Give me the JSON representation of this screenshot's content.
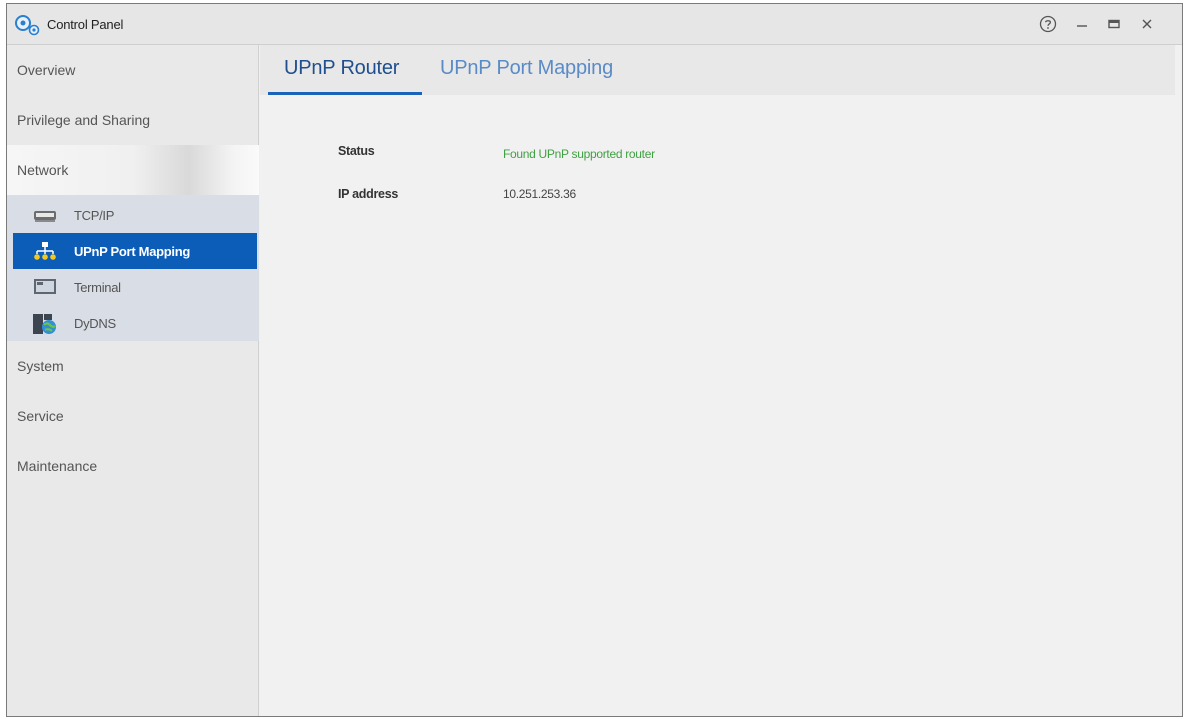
{
  "window": {
    "title": "Control Panel",
    "controls": {
      "help": "?",
      "minimize": "–",
      "maximize": "▭",
      "close": "✕"
    }
  },
  "sidebar": {
    "items": [
      {
        "label": "Overview"
      },
      {
        "label": "Privilege and Sharing"
      },
      {
        "label": "Network"
      },
      {
        "label": "System"
      },
      {
        "label": "Service"
      },
      {
        "label": "Maintenance"
      }
    ],
    "network_subitems": [
      {
        "label": "TCP/IP",
        "icon": "network-card-icon"
      },
      {
        "label": "UPnP Port Mapping",
        "icon": "upnp-icon"
      },
      {
        "label": "Terminal",
        "icon": "terminal-icon"
      },
      {
        "label": "DyDNS",
        "icon": "dydns-icon"
      }
    ]
  },
  "tabs": [
    {
      "label": "UPnP Router"
    },
    {
      "label": "UPnP Port Mapping"
    }
  ],
  "content": {
    "status_label": "Status",
    "status_value": "Found UPnP supported router",
    "ip_label": "IP address",
    "ip_value": "10.251.253.36"
  },
  "colors": {
    "accent": "#0b5db8",
    "status_ok": "#3fa142",
    "tab_active": "#1f4f8e",
    "tab_inactive": "#5a8bc7"
  }
}
